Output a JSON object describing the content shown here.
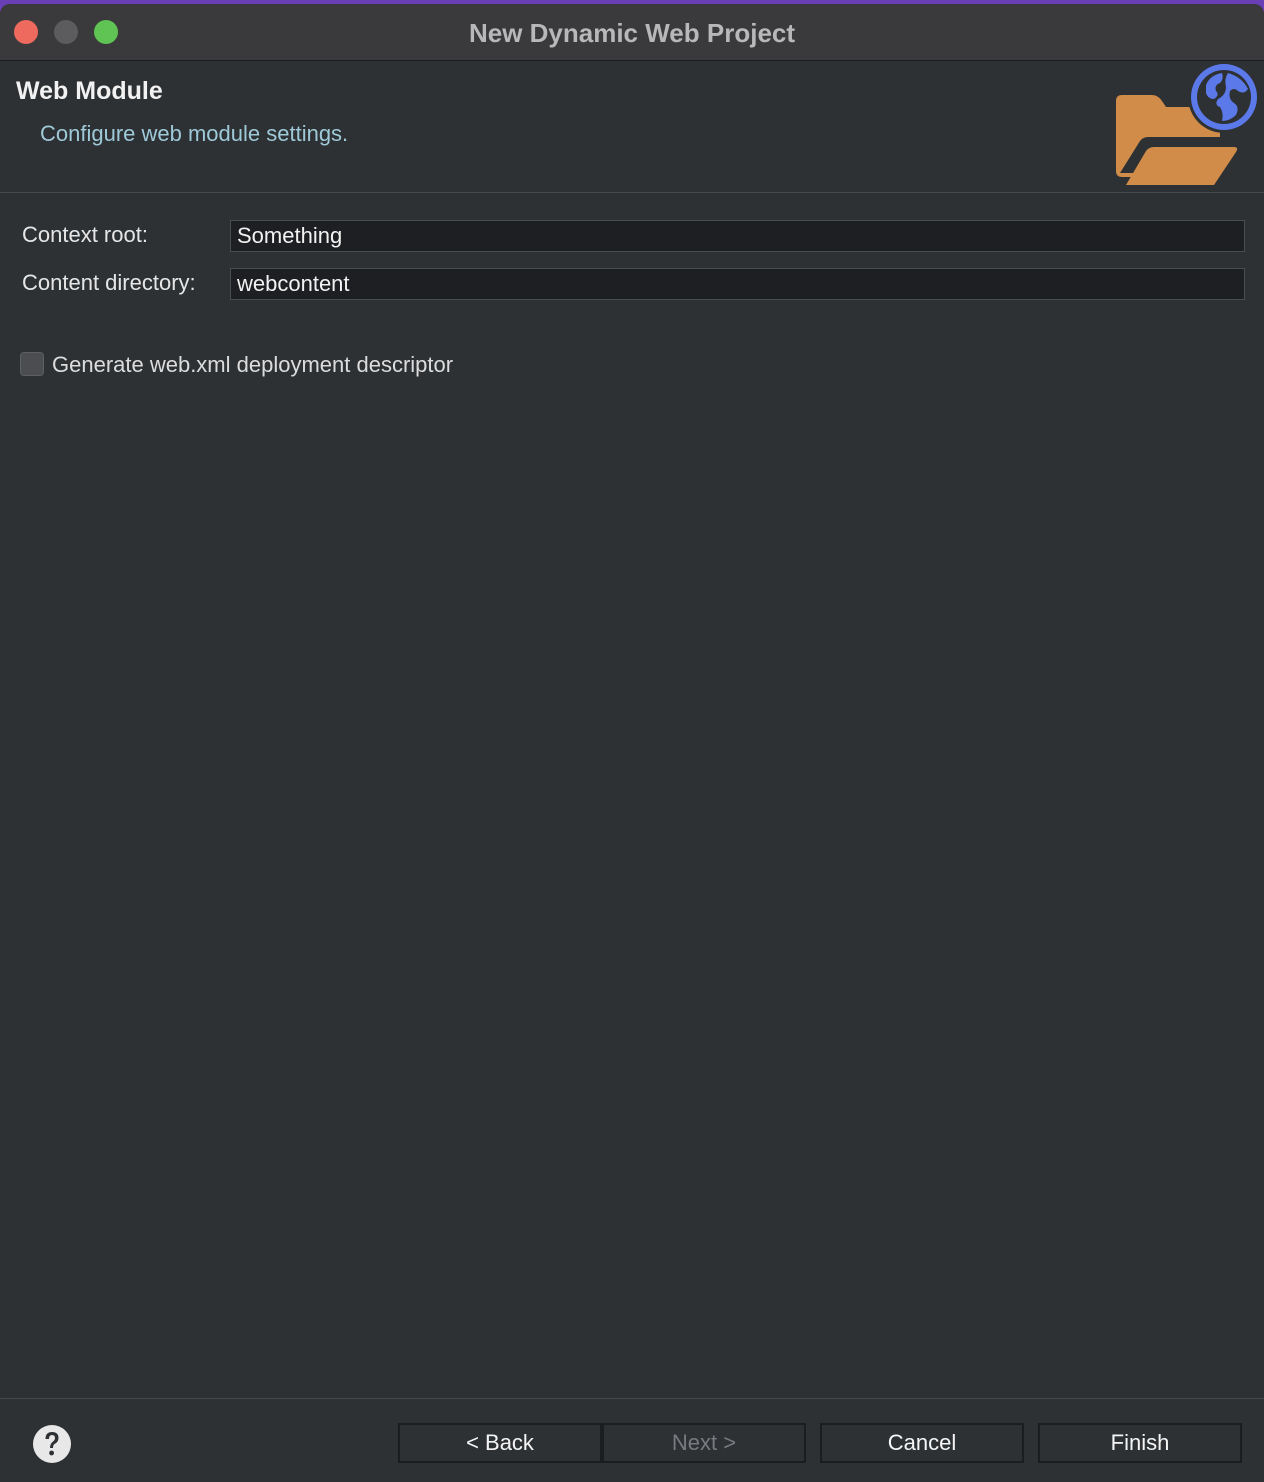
{
  "window": {
    "title": "New Dynamic Web Project"
  },
  "header": {
    "title": "Web Module",
    "description": "Configure web module settings.",
    "icon": "web-project-folder-globe-icon"
  },
  "form": {
    "context_root": {
      "label": "Context root:",
      "value": "Something"
    },
    "content_directory": {
      "label": "Content directory:",
      "value": "webcontent"
    },
    "generate_web_xml": {
      "label": "Generate web.xml deployment descriptor",
      "checked": false
    }
  },
  "footer": {
    "help_icon": "help-icon",
    "back_label": "< Back",
    "next_label": "Next >",
    "cancel_label": "Cancel",
    "finish_label": "Finish"
  },
  "colors": {
    "accent_folder": "#d08c48",
    "accent_globe": "#5b79e9",
    "description_text": "#9ec9d8"
  }
}
